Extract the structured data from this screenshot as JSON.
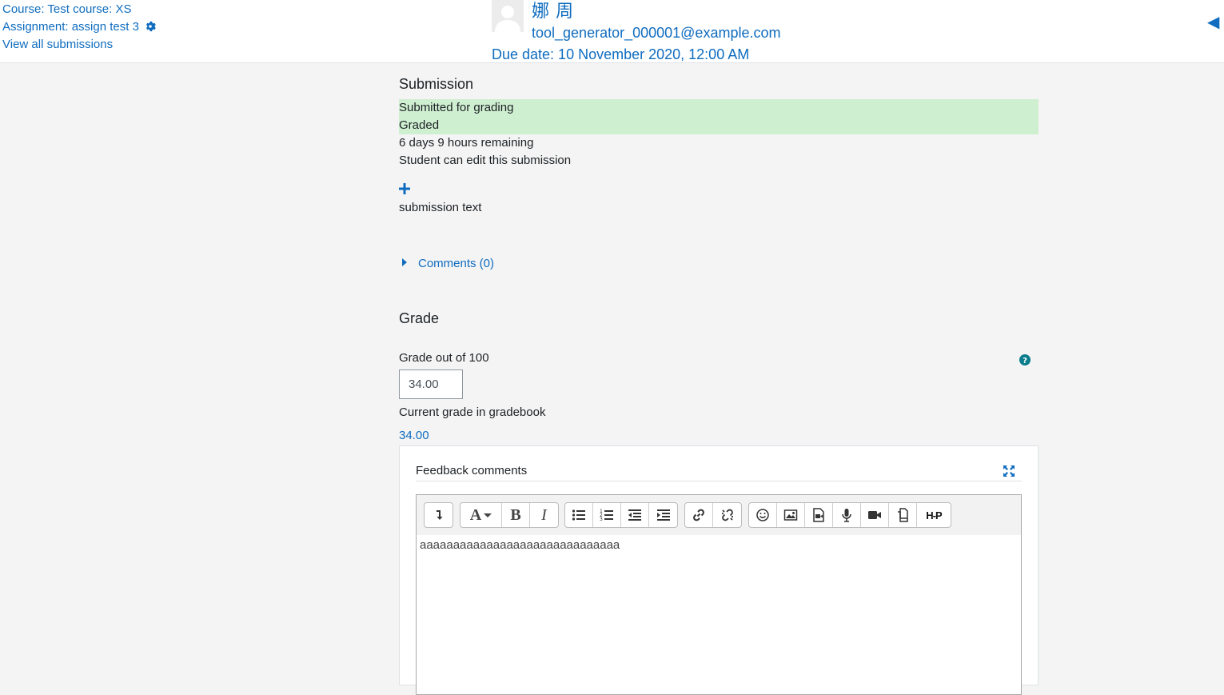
{
  "header": {
    "course_link": "Course: Test course: XS",
    "assignment_link": "Assignment: assign test 3",
    "view_all": "View all submissions",
    "user_name": "娜 周",
    "user_email": "tool_generator_000001@example.com",
    "due_date": "Due date: 10 November 2020, 12:00 AM",
    "collapse_icon": "◀"
  },
  "submission": {
    "title": "Submission",
    "status": [
      {
        "text": "Submitted for grading",
        "highlight": true
      },
      {
        "text": "Graded",
        "highlight": true
      },
      {
        "text": "6 days 9 hours remaining",
        "highlight": false
      },
      {
        "text": "Student can edit this submission",
        "highlight": false
      }
    ],
    "expand_icon": "plus-icon",
    "text": "submission text",
    "comments_link": "Comments (0)"
  },
  "grade": {
    "title": "Grade",
    "label": "Grade out of 100",
    "value": "34.00",
    "current_label": "Current grade in gradebook",
    "current_value": "34.00"
  },
  "feedback": {
    "label": "Feedback comments",
    "editor_text": "aaaaaaaaaaaaaaaaaaaaaaaaaaaaaa",
    "toolbar": {
      "bold": "B",
      "italic": "I",
      "font": "A",
      "h5p": "H-P"
    }
  },
  "colors": {
    "link": "#0f6cbf",
    "status_green": "#cfefd1",
    "help": "#0a7c8c"
  }
}
